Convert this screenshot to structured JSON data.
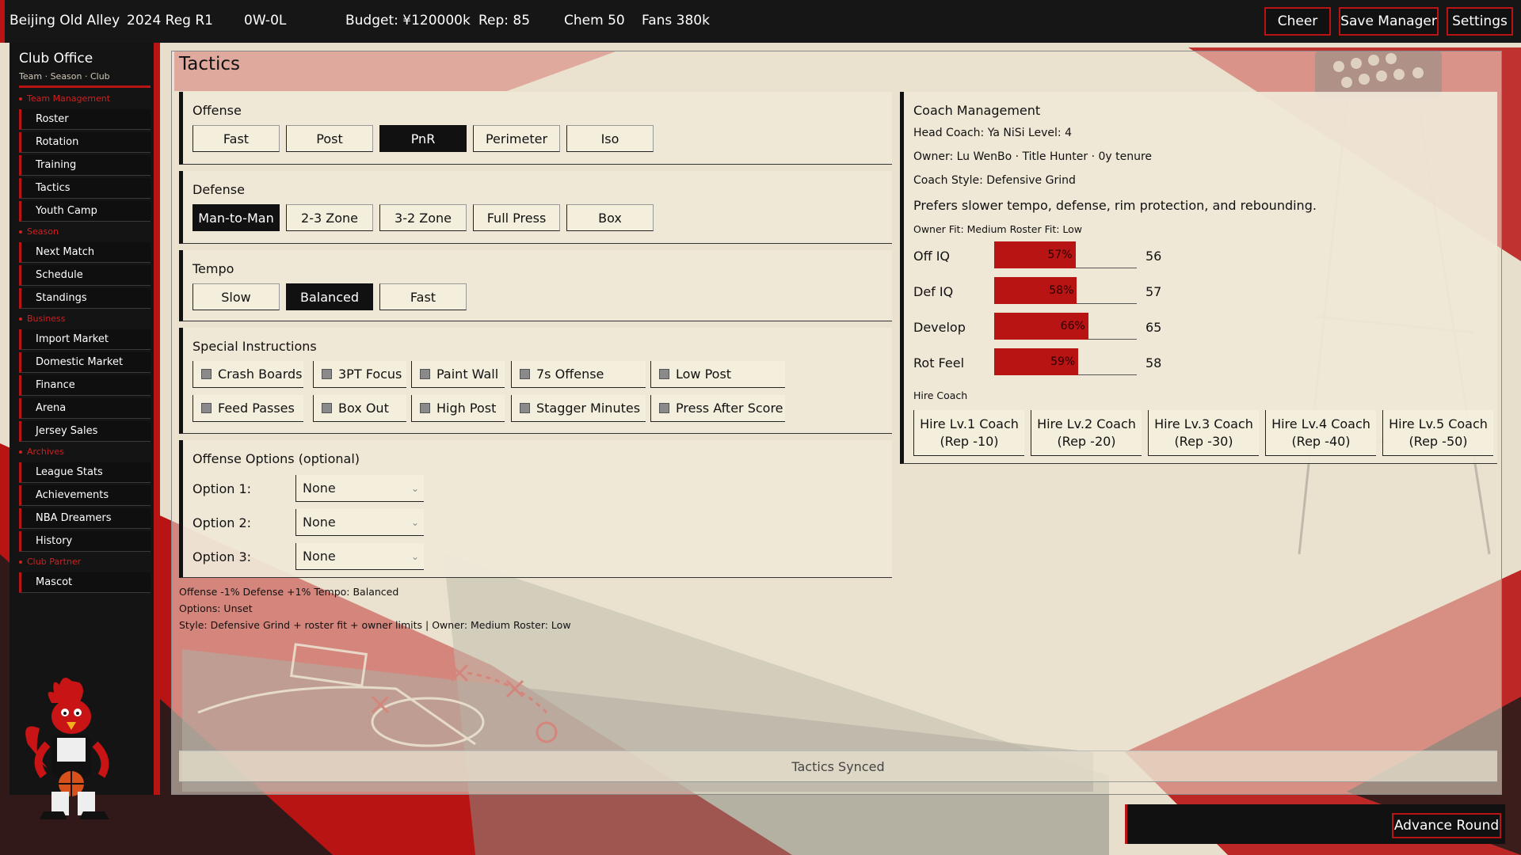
{
  "topbar": {
    "club": "Beijing Old Alley",
    "season": "2024 Reg R1",
    "record": "0W-0L",
    "budget": "Budget: ¥120000k",
    "rep": "Rep: 85",
    "chem": "Chem 50",
    "fans": "Fans 380k",
    "cheer": "Cheer",
    "save_manager": "Save Manager",
    "settings": "Settings"
  },
  "sidebar": {
    "title": "Club Office",
    "subtitle": "Team · Season · Club",
    "sections": {
      "team": "Team Management",
      "season": "Season",
      "business": "Business",
      "archives": "Archives",
      "partner": "Club Partner"
    },
    "items": {
      "roster": "Roster",
      "rotation": "Rotation",
      "training": "Training",
      "tactics": "Tactics",
      "youth": "Youth Camp",
      "next_match": "Next Match",
      "schedule": "Schedule",
      "standings": "Standings",
      "import": "Import Market",
      "domestic": "Domestic Market",
      "finance": "Finance",
      "arena": "Arena",
      "jersey": "Jersey Sales",
      "league_stats": "League Stats",
      "achievements": "Achievements",
      "nba": "NBA Dreamers",
      "history": "History",
      "mascot": "Mascot"
    }
  },
  "main": {
    "title": "Tactics",
    "offense": {
      "title": "Offense",
      "options": [
        "Fast",
        "Post",
        "PnR",
        "Perimeter",
        "Iso"
      ],
      "selected": "PnR"
    },
    "defense": {
      "title": "Defense",
      "options": [
        "Man-to-Man",
        "2-3 Zone",
        "3-2 Zone",
        "Full Press",
        "Box"
      ],
      "selected": "Man-to-Man"
    },
    "tempo": {
      "title": "Tempo",
      "options": [
        "Slow",
        "Balanced",
        "Fast"
      ],
      "selected": "Balanced"
    },
    "special": {
      "title": "Special Instructions",
      "items": [
        "Crash Boards",
        "3PT Focus",
        "Paint Wall",
        "7s Offense",
        "Low Post",
        "Feed Passes",
        "Box Out",
        "High Post",
        "Stagger Minutes",
        "Press After Score"
      ]
    },
    "offense_options": {
      "title": "Offense Options (optional)",
      "labels": [
        "Option 1:",
        "Option 2:",
        "Option 3:"
      ],
      "values": [
        "None",
        "None",
        "None"
      ]
    },
    "summary": {
      "line1": "Offense -1%  Defense +1%  Tempo: Balanced",
      "line2": "Options: Unset",
      "line3": "Style: Defensive Grind + roster fit + owner limits  |  Owner: Medium  Roster: Low"
    },
    "status": "Tactics Synced"
  },
  "coach": {
    "title": "Coach Management",
    "head": "Head Coach: Ya NiSi   Level: 4",
    "owner": "Owner: Lu WenBo · Title Hunter · 0y tenure",
    "style": "Coach Style: Defensive Grind",
    "desc": "Prefers slower tempo, defense, rim protection, and rebounding.",
    "fit": "Owner Fit: Medium   Roster Fit: Low",
    "ratings": [
      {
        "label": "Off IQ",
        "pct": 57,
        "pct_text": "57%",
        "value": "56"
      },
      {
        "label": "Def IQ",
        "pct": 58,
        "pct_text": "58%",
        "value": "57"
      },
      {
        "label": "Develop",
        "pct": 66,
        "pct_text": "66%",
        "value": "65"
      },
      {
        "label": "Rot Feel",
        "pct": 59,
        "pct_text": "59%",
        "value": "58"
      }
    ],
    "hire_title": "Hire Coach",
    "hire": [
      {
        "line1": "Hire Lv.1 Coach",
        "line2": "(Rep -10)"
      },
      {
        "line1": "Hire Lv.2 Coach",
        "line2": "(Rep -20)"
      },
      {
        "line1": "Hire Lv.3 Coach",
        "line2": "(Rep -30)"
      },
      {
        "line1": "Hire Lv.4 Coach",
        "line2": "(Rep -40)"
      },
      {
        "line1": "Hire Lv.5 Coach",
        "line2": "(Rep -50)"
      }
    ]
  },
  "footer": {
    "advance": "Advance Round"
  },
  "colors": {
    "accent": "#b81414",
    "dark": "#141414",
    "paper": "#e9e1d0"
  }
}
